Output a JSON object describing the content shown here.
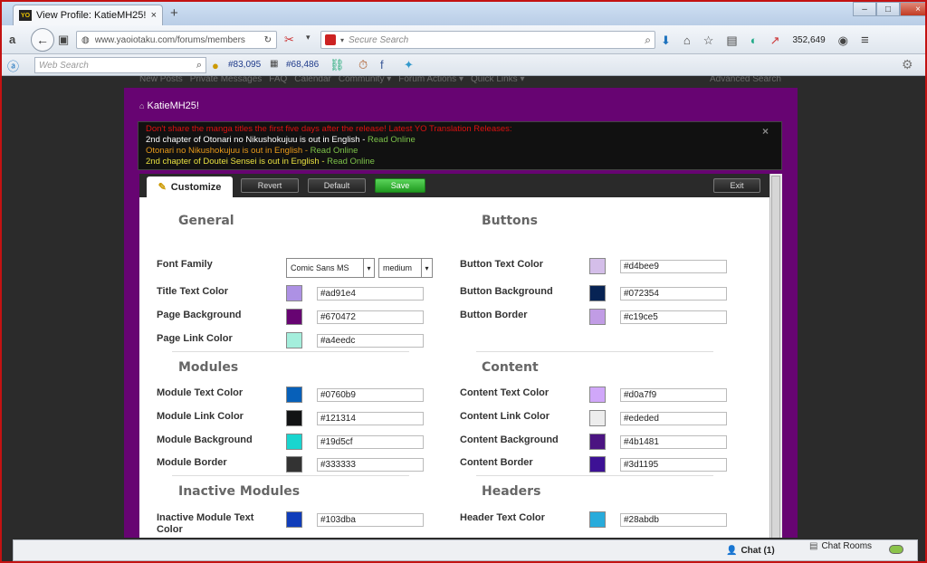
{
  "browser": {
    "tab_title": "View Profile: KatieMH25! - ...",
    "tab_close": "×",
    "new_tab": "+",
    "url": "www.yaoiotaku.com/forums/members",
    "search_placeholder": "Secure Search",
    "count": "352,649",
    "window_controls": {
      "min": "–",
      "max": "□",
      "close": "×"
    }
  },
  "toolbar": {
    "web_search_placeholder": "Web Search",
    "stat1": "#83,095",
    "stat2": "#68,486"
  },
  "site": {
    "nav_items": [
      "New Posts",
      "Private Messages",
      "FAQ",
      "Calendar",
      "Community ▾",
      "Forum Actions ▾",
      "Quick Links ▾"
    ],
    "advanced_search": "Advanced Search",
    "breadcrumb": "KatieMH25!",
    "announcement": {
      "warning": "Don't share the manga titles the first five days after the release! Latest YO Translation Releases:",
      "lines": [
        {
          "text": "2nd chapter of Otonari no Nikushokujuu is out in English - ",
          "link": "Read Online"
        },
        {
          "text": "Otonari no Nikushokujuu is out in English - ",
          "link": "Read Online"
        },
        {
          "text": "2nd chapter of Doutei Sensei is out in English - ",
          "link": "Read Online"
        }
      ],
      "close": "×"
    }
  },
  "customize": {
    "tab_label": "Customize",
    "buttons": {
      "revert": "Revert",
      "default": "Default",
      "save": "Save",
      "exit": "Exit"
    },
    "sections": {
      "general": "General",
      "buttons": "Buttons",
      "modules": "Modules",
      "content": "Content",
      "inactive_modules": "Inactive Modules",
      "headers": "Headers"
    },
    "font_family": {
      "label": "Font Family",
      "value": "Comic Sans MS",
      "size": "medium"
    },
    "left_fields": [
      {
        "label": "Title Text Color",
        "value": "#ad91e4"
      },
      {
        "label": "Page Background",
        "value": "#670472"
      },
      {
        "label": "Page Link Color",
        "value": "#a4eedc"
      },
      {
        "label": "Module Text Color",
        "value": "#0760b9"
      },
      {
        "label": "Module Link Color",
        "value": "#121314"
      },
      {
        "label": "Module Background",
        "value": "#19d5cf"
      },
      {
        "label": "Module Border",
        "value": "#333333"
      },
      {
        "label": "Inactive Module Text Color",
        "value": "#103dba"
      }
    ],
    "right_fields": [
      {
        "label": "Button Text Color",
        "value": "#d4bee9"
      },
      {
        "label": "Button Background",
        "value": "#072354"
      },
      {
        "label": "Button Border",
        "value": "#c19ce5"
      },
      {
        "label": "Content Text Color",
        "value": "#d0a7f9"
      },
      {
        "label": "Content Link Color",
        "value": "#ededed"
      },
      {
        "label": "Content Background",
        "value": "#4b1481"
      },
      {
        "label": "Content Border",
        "value": "#3d1195"
      },
      {
        "label": "Header Text Color",
        "value": "#28abdb"
      }
    ]
  },
  "statusbar": {
    "chat": "Chat (1)",
    "chat_rooms": "Chat Rooms"
  }
}
